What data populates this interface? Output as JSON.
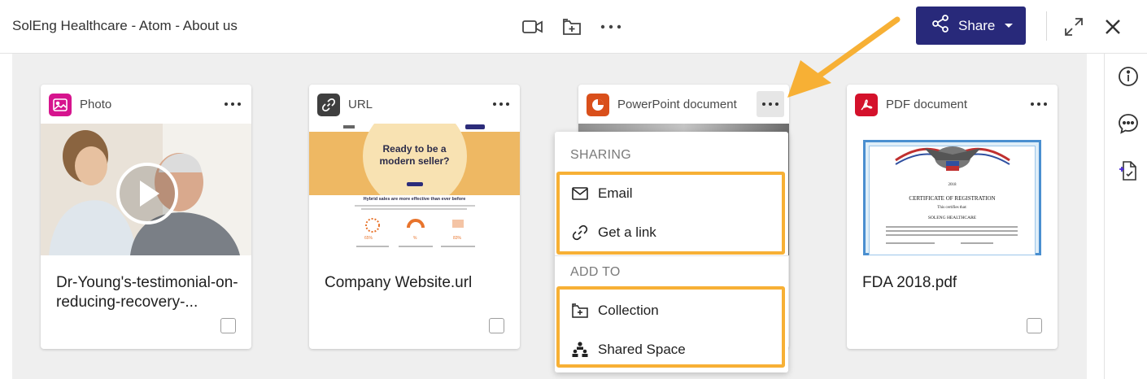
{
  "header": {
    "title": "SolEng Healthcare - Atom - About us",
    "share_label": "Share"
  },
  "icons": {
    "video": "video-camera-icon",
    "add_collection": "add-to-collection-icon",
    "more": "more-horizontal-icon",
    "share": "share-nodes-icon",
    "expand": "expand-icon",
    "close": "close-icon",
    "info": "info-icon",
    "comments": "comment-icon",
    "new_doc": "new-document-icon"
  },
  "colors": {
    "share_button": "#28297a",
    "annotation": "#f7b035",
    "photo_type": "#d6148e",
    "url_type": "#3f3f3f",
    "ppt_type": "#d94f1b",
    "pdf_type": "#d4112b"
  },
  "cards": [
    {
      "type_label": "Photo",
      "title": "Dr-Young's-testimonial-on-reducing-recovery-..."
    },
    {
      "type_label": "URL",
      "title": "Company Website.url"
    },
    {
      "type_label": "PowerPoint document",
      "title": ""
    },
    {
      "type_label": "PDF document",
      "title": "FDA 2018.pdf"
    }
  ],
  "url_thumb": {
    "headline_1": "Ready to be a",
    "headline_2": "modern seller?",
    "subhead": "Hybrid sales are more effective than ever before",
    "stats": [
      "65%",
      "%",
      "83%"
    ]
  },
  "pdf_thumb": {
    "year": "2018",
    "heading": "CERTIFICATE OF REGISTRATION",
    "certifies": "This certifies that:",
    "org": "SOLENG HEALTHCARE"
  },
  "menu": {
    "sharing_header": "SHARING",
    "email": "Email",
    "get_link": "Get a link",
    "add_to_header": "ADD TO",
    "collection": "Collection",
    "shared_space": "Shared Space"
  }
}
